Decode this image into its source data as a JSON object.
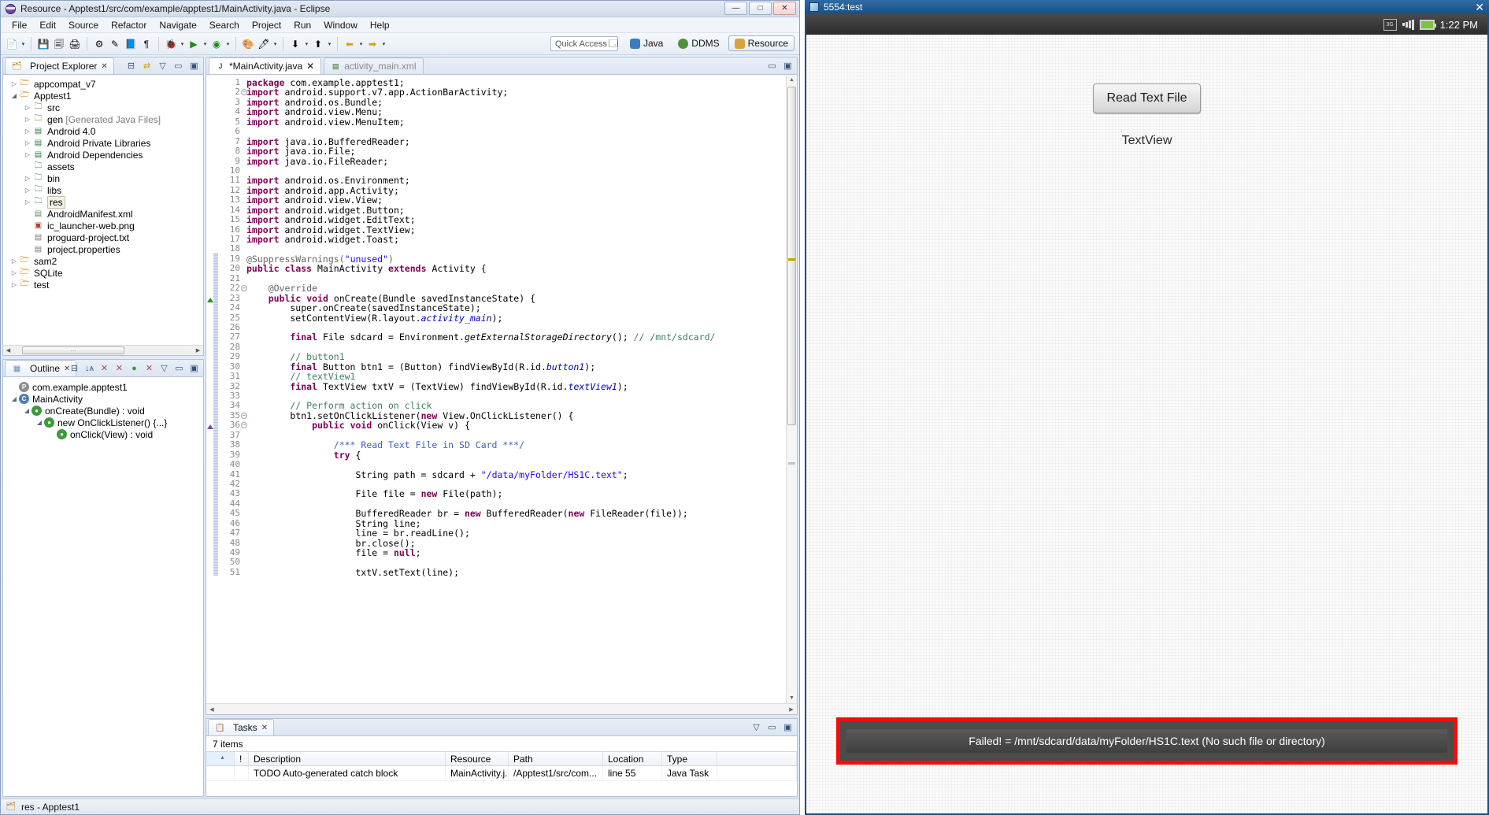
{
  "eclipse": {
    "title": "Resource - Apptest1/src/com/example/apptest1/MainActivity.java - Eclipse",
    "window_buttons": [
      {
        "name": "minimize",
        "glyph": "—"
      },
      {
        "name": "maximize",
        "glyph": "□"
      },
      {
        "name": "close",
        "glyph": "✕"
      }
    ],
    "menus": [
      "File",
      "Edit",
      "Source",
      "Refactor",
      "Navigate",
      "Search",
      "Project",
      "Run",
      "Window",
      "Help"
    ],
    "toolbar": {
      "quick_access_placeholder": "Quick Access",
      "perspectives": [
        {
          "label": "Java",
          "active": false,
          "color": "#3b7dbd"
        },
        {
          "label": "DDMS",
          "active": false,
          "color": "#4f8f3f"
        },
        {
          "label": "Resource",
          "active": true,
          "color": "#d9a33c"
        }
      ]
    },
    "project_explorer": {
      "tab_label": "Project Explorer",
      "items": [
        {
          "label": "appcompat_v7",
          "depth": 0,
          "arrow": "▷",
          "icon": "project-icon",
          "selected": false
        },
        {
          "label": "Apptest1",
          "depth": 0,
          "arrow": "◢",
          "icon": "project-warn-icon",
          "selected": false
        },
        {
          "label": "src",
          "depth": 1,
          "arrow": "▷",
          "icon": "source-folder-icon",
          "selected": false
        },
        {
          "label": "gen",
          "suffix": " [Generated Java Files]",
          "depth": 1,
          "arrow": "▷",
          "icon": "source-folder-icon",
          "selected": false
        },
        {
          "label": "Android 4.0",
          "depth": 1,
          "arrow": "▷",
          "icon": "library-icon",
          "selected": false
        },
        {
          "label": "Android Private Libraries",
          "depth": 1,
          "arrow": "▷",
          "icon": "library-icon",
          "selected": false
        },
        {
          "label": "Android Dependencies",
          "depth": 1,
          "arrow": "▷",
          "icon": "library-icon",
          "selected": false
        },
        {
          "label": "assets",
          "depth": 1,
          "arrow": "",
          "icon": "folder-icon",
          "selected": false
        },
        {
          "label": "bin",
          "depth": 1,
          "arrow": "▷",
          "icon": "folder-icon",
          "selected": false
        },
        {
          "label": "libs",
          "depth": 1,
          "arrow": "▷",
          "icon": "folder-icon",
          "selected": false
        },
        {
          "label": "res",
          "depth": 1,
          "arrow": "▷",
          "icon": "folder-warn-icon",
          "selected": true
        },
        {
          "label": "AndroidManifest.xml",
          "depth": 1,
          "arrow": "",
          "icon": "xml-file-icon",
          "selected": false
        },
        {
          "label": "ic_launcher-web.png",
          "depth": 1,
          "arrow": "",
          "icon": "image-file-icon",
          "selected": false
        },
        {
          "label": "proguard-project.txt",
          "depth": 1,
          "arrow": "",
          "icon": "text-file-icon",
          "selected": false
        },
        {
          "label": "project.properties",
          "depth": 1,
          "arrow": "",
          "icon": "text-file-icon",
          "selected": false
        },
        {
          "label": "sam2",
          "depth": 0,
          "arrow": "▷",
          "icon": "project-error-icon",
          "selected": false
        },
        {
          "label": "SQLite",
          "depth": 0,
          "arrow": "▷",
          "icon": "project-error-icon",
          "selected": false
        },
        {
          "label": "test",
          "depth": 0,
          "arrow": "▷",
          "icon": "project-warn-icon",
          "selected": false
        }
      ]
    },
    "outline": {
      "tab_label": "Outline",
      "items": [
        {
          "label": "com.example.apptest1",
          "depth": 0,
          "arrow": "",
          "badge": "P",
          "color": "#8d8d8d"
        },
        {
          "label": "MainActivity",
          "depth": 0,
          "arrow": "◢",
          "badge": "C",
          "color": "#4a7ebb"
        },
        {
          "label": "onCreate(Bundle) : void",
          "depth": 1,
          "arrow": "◢",
          "badge": "●",
          "color": "#3c9a3c"
        },
        {
          "label": "new OnClickListener() {...}",
          "depth": 2,
          "arrow": "◢",
          "badge": "●",
          "color": "#3c9a3c"
        },
        {
          "label": "onClick(View) : void",
          "depth": 3,
          "arrow": "",
          "badge": "●",
          "color": "#3c9a3c"
        }
      ]
    },
    "editor": {
      "tabs": [
        {
          "label": "*MainActivity.java",
          "active": true,
          "icon": "java-file-icon"
        },
        {
          "label": "activity_main.xml",
          "active": false,
          "icon": "xml-file-icon"
        }
      ],
      "first_line": 1,
      "lines": [
        "package com.example.apptest1;",
        "import android.support.v7.app.ActionBarActivity;",
        "import android.os.Bundle;",
        "import android.view.Menu;",
        "import android.view.MenuItem;",
        "",
        "import java.io.BufferedReader;",
        "import java.io.File;",
        "import java.io.FileReader;",
        "",
        "import android.os.Environment;",
        "import android.app.Activity;",
        "import android.view.View;",
        "import android.widget.Button;",
        "import android.widget.EditText;",
        "import android.widget.TextView;",
        "import android.widget.Toast;",
        "",
        "@SuppressWarnings(\"unused\")",
        "public class MainActivity extends Activity {",
        "",
        "    @Override",
        "    public void onCreate(Bundle savedInstanceState) {",
        "        super.onCreate(savedInstanceState);",
        "        setContentView(R.layout.activity_main);",
        "",
        "        final File sdcard = Environment.getExternalStorageDirectory(); // /mnt/sdcard/",
        "",
        "        // button1",
        "        final Button btn1 = (Button) findViewById(R.id.button1);",
        "        // textView1",
        "        final TextView txtV = (TextView) findViewById(R.id.textView1);",
        "",
        "        // Perform action on click",
        "        btn1.setOnClickListener(new View.OnClickListener() {",
        "            public void onClick(View v) {",
        "",
        "                /*** Read Text File in SD Card ***/",
        "                try {",
        "",
        "                    String path = sdcard + \"/data/myFolder/HS1C.text\";",
        "",
        "                    File file = new File(path);",
        "",
        "                    BufferedReader br = new BufferedReader(new FileReader(file));",
        "                    String line;",
        "                    line = br.readLine();",
        "                    br.close();",
        "                    file = null;",
        "",
        "                    txtV.setText(line);"
      ]
    },
    "tasks": {
      "tab_label": "Tasks",
      "count_label": "7 items",
      "columns": [
        "",
        "!",
        "Description",
        "Resource",
        "Path",
        "Location",
        "Type",
        ""
      ],
      "rows": [
        {
          "description": "TODO Auto-generated catch block",
          "resource": "MainActivity.j...",
          "path": "/Apptest1/src/com...",
          "location": "line 55",
          "type": "Java Task"
        }
      ]
    },
    "statusbar": {
      "text": "res - Apptest1"
    }
  },
  "emulator": {
    "window_title": "5554:test",
    "close_glyph": "✕",
    "status": {
      "signal_label": "3G",
      "time": "1:22 PM"
    },
    "app": {
      "button_label": "Read Text File",
      "textview_label": "TextView",
      "toast_message": "Failed! = /mnt/sdcard/data/myFolder/HS1C.text (No such file or directory)"
    }
  }
}
